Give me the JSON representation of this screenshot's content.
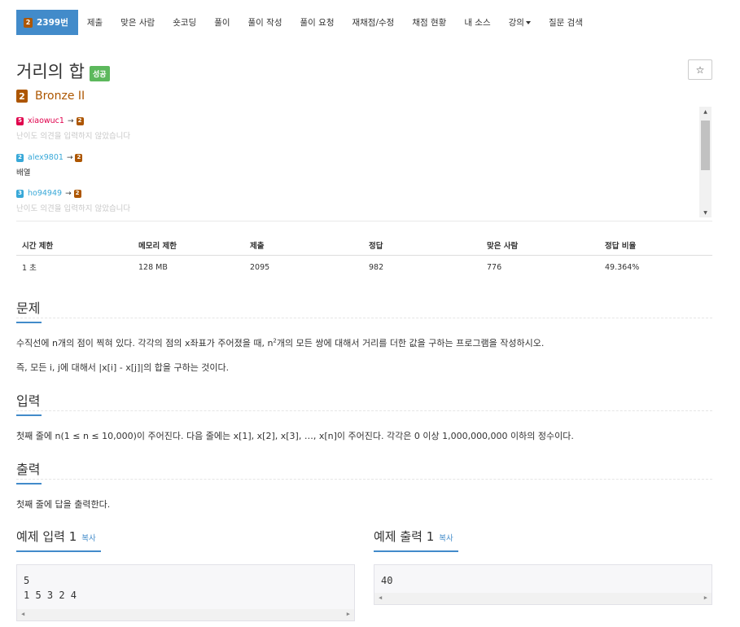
{
  "nav": {
    "problem_tab": {
      "tier": "2",
      "label": "2399번"
    },
    "tabs": [
      "제출",
      "맞은 사람",
      "숏코딩",
      "풀이",
      "풀이 작성",
      "풀이 요청",
      "재채점/수정",
      "채점 현황",
      "내 소스"
    ],
    "lecture": "강의",
    "qna": "질문 검색"
  },
  "problem": {
    "title": "거리의 합",
    "status": "성공",
    "star": "☆",
    "tier_num": "2",
    "tier_name": "Bronze II"
  },
  "opinions": [
    {
      "user": "xiaowuc1",
      "from": "5",
      "to": "2",
      "text": "난이도 의견을 입력하지 않았습니다",
      "user_color": "#e0004c"
    },
    {
      "user": "alex9801",
      "from": "2",
      "to": "2",
      "text": "배열",
      "user_color": "#38a8d8"
    },
    {
      "user": "ho94949",
      "from": "3",
      "to": "2",
      "text": "난이도 의견을 입력하지 않았습니다",
      "user_color": "#38a8d8"
    }
  ],
  "arrow": "→",
  "info": {
    "headers": [
      "시간 제한",
      "메모리 제한",
      "제출",
      "정답",
      "맞은 사람",
      "정답 비율"
    ],
    "values": [
      "1 초",
      "128 MB",
      "2095",
      "982",
      "776",
      "49.364%"
    ]
  },
  "sections": {
    "problem_heading": "문제",
    "problem_p1_a": "수직선에 n개의 점이 찍혀 있다. 각각의 점의 x좌표가 주어졌을 때, n",
    "problem_p1_sup": "2",
    "problem_p1_b": "개의 모든 쌍에 대해서 거리를 더한 값을 구하는 프로그램을 작성하시오.",
    "problem_p2": "즉, 모든 i, j에 대해서 |x[i] - x[j]|의 합을 구하는 것이다.",
    "input_heading": "입력",
    "input_p": "첫째 줄에 n(1 ≤ n ≤ 10,000)이 주어진다. 다음 줄에는 x[1], x[2], x[3], …, x[n]이 주어진다. 각각은 0 이상 1,000,000,000 이하의 정수이다.",
    "output_heading": "출력",
    "output_p": "첫째 줄에 답을 출력한다."
  },
  "samples": {
    "input_title": "예제 입력 1",
    "output_title": "예제 출력 1",
    "copy": "복사",
    "input_lines": [
      "5",
      "1 5 3 2 4"
    ],
    "output_lines": [
      "40"
    ]
  },
  "colors": {
    "primary": "#428bca",
    "bronze": "#ad5600",
    "success": "#5cb85c"
  }
}
